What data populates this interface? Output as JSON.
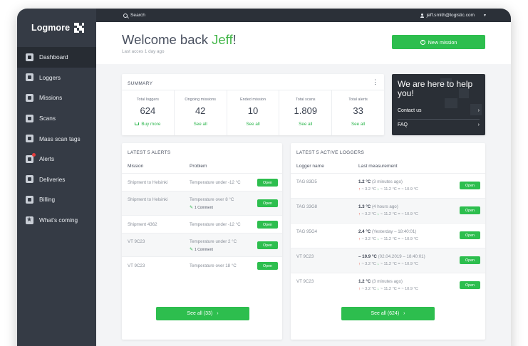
{
  "app": {
    "name": "Logmore",
    "user_email": "jeff.smith@logistic.com",
    "search_label": "Search",
    "accent_color": "#2dbe4e"
  },
  "sidebar": {
    "items": [
      {
        "label": "Dashboard",
        "icon": "dashboard-icon",
        "active": true
      },
      {
        "label": "Loggers",
        "icon": "logger-icon"
      },
      {
        "label": "Missions",
        "icon": "missions-icon"
      },
      {
        "label": "Scans",
        "icon": "scan-icon"
      },
      {
        "label": "Mass scan tags",
        "icon": "mass-scan-icon"
      },
      {
        "label": "Alerts",
        "icon": "alert-icon",
        "badge": "red-dot"
      },
      {
        "label": "Deliveries",
        "icon": "delivery-icon"
      },
      {
        "label": "Billing",
        "icon": "billing-icon"
      },
      {
        "label": "What's coming",
        "icon": "star-icon"
      }
    ]
  },
  "header": {
    "welcome_prefix": "Welcome back ",
    "user_name": "Jeff",
    "welcome_suffix": "!",
    "last_access": "Last acces 1 day ago",
    "new_mission_label": "New mission"
  },
  "summary": {
    "title": "SUMMARY",
    "stats": [
      {
        "label": "Total loggers",
        "value": "624",
        "link": "Buy more"
      },
      {
        "label": "Ongoing missions",
        "value": "42",
        "link": "See all"
      },
      {
        "label": "Ended mission",
        "value": "10",
        "link": "See all"
      },
      {
        "label": "Total scans",
        "value": "1.809",
        "link": "See all"
      },
      {
        "label": "Total alerts",
        "value": "33",
        "link": "See all"
      }
    ]
  },
  "help": {
    "title": "We are here to help you!",
    "contact": "Contact us",
    "faq": "FAQ"
  },
  "alerts": {
    "title": "LATEST 5 ALERTS",
    "col_mission": "Mission",
    "col_problem": "Problem",
    "open_label": "Open",
    "see_all_label": "See all (33)",
    "rows": [
      {
        "mission": "Shipment to Helsinki",
        "problem": "Temperature under -12 °C",
        "comment": ""
      },
      {
        "mission": "Shipment to Helsinki",
        "problem": "Temperature over 8 °C",
        "comment": "1 Comment"
      },
      {
        "mission": "Shipment 4362",
        "problem": "Temperature under -12 °C",
        "comment": ""
      },
      {
        "mission": "VT 9C23",
        "problem": "Temperature under 2 °C",
        "comment": "1 Comment"
      },
      {
        "mission": "VT 9C23",
        "problem": "Temperature over 18 °C",
        "comment": ""
      }
    ]
  },
  "loggers": {
    "title": "LATEST 5 ACTIVE LOGGERS",
    "col_name": "Logger name",
    "col_measurement": "Last measurement",
    "open_label": "Open",
    "see_all_label": "See all (624)",
    "rows": [
      {
        "name": "TAG 83D5",
        "value": "1.2 °C",
        "when": "(3 minutes ago)",
        "max": "~ 3.2 °C",
        "min": "~ 11.2 °C",
        "avg": "~ 10.9 °C"
      },
      {
        "name": "TAG 33G8",
        "value": "1.3 °C",
        "when": "(4 hours ago)",
        "max": "~ 3.2 °C",
        "min": "~ 11.2 °C",
        "avg": "~ 10.9 °C"
      },
      {
        "name": "TAG 95G4",
        "value": "2.4 °C",
        "when": "(Yesterday – 18:40:01)",
        "max": "~ 3.2 °C",
        "min": "~ 11.2 °C",
        "avg": "~ 10.9 °C"
      },
      {
        "name": "VT 9C23",
        "value": "– 10.9 °C",
        "when": "(02.04.2019 – 18:40:01)",
        "max": "~ 3.2 °C",
        "min": "~ 11.2 °C",
        "avg": "~ 10.9 °C"
      },
      {
        "name": "VT 9C23",
        "value": "1.2 °C",
        "when": "(3 minutes ago)",
        "max": "~ 3.2 °C",
        "min": "~ 11.2 °C",
        "avg": "~ 10.9 °C"
      }
    ]
  }
}
